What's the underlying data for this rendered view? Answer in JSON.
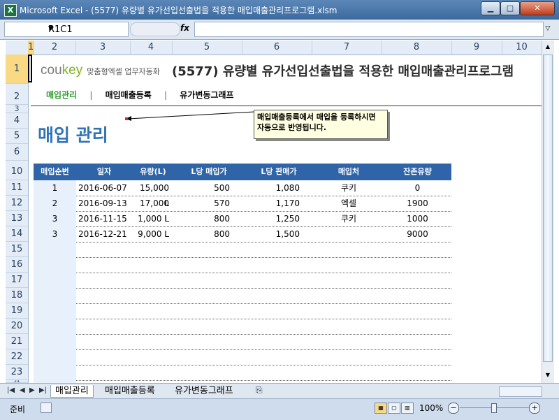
{
  "window": {
    "title": "Microsoft Excel - (5577) 유량별 유가선입선출법을 적용한 매입매출관리프로그램.xlsm",
    "app_icon": "X",
    "min_glyph": "▁",
    "max_glyph": "□",
    "close_glyph": "✕"
  },
  "formula_bar": {
    "name_box": "R1C1",
    "fx_label": "fx",
    "formula": ""
  },
  "columns": [
    "1",
    "2",
    "3",
    "4",
    "5",
    "6",
    "7",
    "8",
    "9",
    "10"
  ],
  "rows": [
    "1",
    "2",
    "3",
    "4",
    "5",
    "6",
    "10",
    "11",
    "12",
    "13",
    "14",
    "15",
    "16",
    "17",
    "18",
    "19",
    "20",
    "21",
    "22",
    "23",
    "24"
  ],
  "header": {
    "logo_co": "cou",
    "logo_key": "key",
    "logo_tagline": "맞춤형엑셀 업무자동화",
    "title": "(5577) 유량별 유가선입선출법을 적용한 매입매출관리프로그램"
  },
  "nav": {
    "items": [
      "매입관리",
      "매입매출등록",
      "유가변동그래프"
    ],
    "separator": "|"
  },
  "page_heading": "매입 관리",
  "note": "매입매출등록에서 매입을 등록하시면 자동으로 반영됩니다.",
  "table": {
    "headers": [
      "매입순번",
      "일자",
      "유량(L)",
      "L당 매입가",
      "L당 판매가",
      "매입처",
      "잔존유량"
    ],
    "rows": [
      [
        "1",
        "2016-06-07",
        "15,000 L",
        "500",
        "1,080",
        "쿠키",
        "0"
      ],
      [
        "2",
        "2016-09-13",
        "17,000 L",
        "570",
        "1,170",
        "엑셀",
        "1900"
      ],
      [
        "3",
        "2016-11-15",
        "1,000 L",
        "800",
        "1,250",
        "쿠키",
        "1000"
      ],
      [
        "3",
        "2016-12-21",
        "9,000 L",
        "800",
        "1,500",
        "",
        "9000"
      ]
    ],
    "empty_rows": 10
  },
  "sheet_tabs": [
    "매입관리",
    "매입매출등록",
    "유가변동그래프"
  ],
  "status": {
    "ready": "준비",
    "zoom": "100%"
  },
  "colors": {
    "accent": "#2f65a8",
    "heading": "#2f73b8",
    "active_nav": "#2e9c2e"
  }
}
